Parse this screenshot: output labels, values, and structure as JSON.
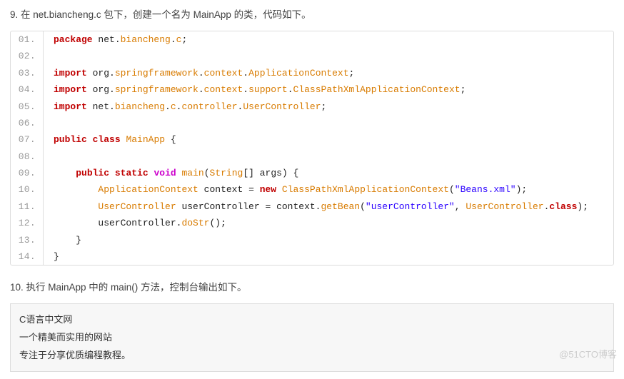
{
  "step9": {
    "heading": "9. 在 net.biancheng.c 包下，创建一个名为 MainApp 的类，代码如下。"
  },
  "code": {
    "lines": [
      {
        "num": "01.",
        "tokens": [
          {
            "cls": "kw-red-bold",
            "t": "package"
          },
          {
            "cls": "tok-container",
            "t": " net."
          },
          {
            "cls": "tok-orange",
            "t": "biancheng"
          },
          {
            "cls": "tok-container",
            "t": "."
          },
          {
            "cls": "tok-orange",
            "t": "c"
          },
          {
            "cls": "tok-container",
            "t": ";"
          }
        ]
      },
      {
        "num": "02.",
        "tokens": []
      },
      {
        "num": "03.",
        "tokens": [
          {
            "cls": "kw-red-bold",
            "t": "import"
          },
          {
            "cls": "tok-container",
            "t": " org."
          },
          {
            "cls": "tok-orange",
            "t": "springframework"
          },
          {
            "cls": "tok-container",
            "t": "."
          },
          {
            "cls": "tok-orange",
            "t": "context"
          },
          {
            "cls": "tok-container",
            "t": "."
          },
          {
            "cls": "tok-orange",
            "t": "ApplicationContext"
          },
          {
            "cls": "tok-container",
            "t": ";"
          }
        ]
      },
      {
        "num": "04.",
        "tokens": [
          {
            "cls": "kw-red-bold",
            "t": "import"
          },
          {
            "cls": "tok-container",
            "t": " org."
          },
          {
            "cls": "tok-orange",
            "t": "springframework"
          },
          {
            "cls": "tok-container",
            "t": "."
          },
          {
            "cls": "tok-orange",
            "t": "context"
          },
          {
            "cls": "tok-container",
            "t": "."
          },
          {
            "cls": "tok-orange",
            "t": "support"
          },
          {
            "cls": "tok-container",
            "t": "."
          },
          {
            "cls": "tok-orange",
            "t": "ClassPathXmlApplicationContext"
          },
          {
            "cls": "tok-container",
            "t": ";"
          }
        ]
      },
      {
        "num": "05.",
        "tokens": [
          {
            "cls": "kw-red-bold",
            "t": "import"
          },
          {
            "cls": "tok-container",
            "t": " net."
          },
          {
            "cls": "tok-orange",
            "t": "biancheng"
          },
          {
            "cls": "tok-container",
            "t": "."
          },
          {
            "cls": "tok-orange",
            "t": "c"
          },
          {
            "cls": "tok-container",
            "t": "."
          },
          {
            "cls": "tok-orange",
            "t": "controller"
          },
          {
            "cls": "tok-container",
            "t": "."
          },
          {
            "cls": "tok-orange",
            "t": "UserController"
          },
          {
            "cls": "tok-container",
            "t": ";"
          }
        ]
      },
      {
        "num": "06.",
        "tokens": []
      },
      {
        "num": "07.",
        "tokens": [
          {
            "cls": "kw-red-bold",
            "t": "public"
          },
          {
            "cls": "tok-plain",
            "t": " "
          },
          {
            "cls": "kw-red-bold",
            "t": "class"
          },
          {
            "cls": "tok-plain",
            "t": " "
          },
          {
            "cls": "tok-orange",
            "t": "MainApp"
          },
          {
            "cls": "tok-plain",
            "t": " {"
          }
        ]
      },
      {
        "num": "08.",
        "tokens": []
      },
      {
        "num": "09.",
        "indent": "    ",
        "tokens": [
          {
            "cls": "kw-red-bold",
            "t": "public"
          },
          {
            "cls": "tok-plain",
            "t": " "
          },
          {
            "cls": "kw-red-bold",
            "t": "static"
          },
          {
            "cls": "tok-plain",
            "t": " "
          },
          {
            "cls": "kw-pink-bold",
            "t": "void"
          },
          {
            "cls": "tok-plain",
            "t": " "
          },
          {
            "cls": "tok-orange",
            "t": "main"
          },
          {
            "cls": "tok-plain",
            "t": "("
          },
          {
            "cls": "tok-orange",
            "t": "String"
          },
          {
            "cls": "tok-plain",
            "t": "[] args) {"
          }
        ]
      },
      {
        "num": "10.",
        "indent": "        ",
        "tokens": [
          {
            "cls": "tok-orange",
            "t": "ApplicationContext"
          },
          {
            "cls": "tok-plain",
            "t": " context = "
          },
          {
            "cls": "kw-red-bold",
            "t": "new"
          },
          {
            "cls": "tok-plain",
            "t": " "
          },
          {
            "cls": "tok-orange",
            "t": "ClassPathXmlApplicationContext"
          },
          {
            "cls": "tok-plain",
            "t": "("
          },
          {
            "cls": "tok-str",
            "t": "\"Beans.xml\""
          },
          {
            "cls": "tok-plain",
            "t": ");"
          }
        ]
      },
      {
        "num": "11.",
        "indent": "        ",
        "tokens": [
          {
            "cls": "tok-orange",
            "t": "UserController"
          },
          {
            "cls": "tok-plain",
            "t": " userController = context."
          },
          {
            "cls": "tok-orange",
            "t": "getBean"
          },
          {
            "cls": "tok-plain",
            "t": "("
          },
          {
            "cls": "tok-str",
            "t": "\"userController\""
          },
          {
            "cls": "tok-plain",
            "t": ", "
          },
          {
            "cls": "tok-orange",
            "t": "UserController"
          },
          {
            "cls": "tok-plain",
            "t": "."
          },
          {
            "cls": "kw-red-bold",
            "t": "class"
          },
          {
            "cls": "tok-plain",
            "t": ");"
          }
        ]
      },
      {
        "num": "12.",
        "indent": "        ",
        "tokens": [
          {
            "cls": "tok-plain",
            "t": "userController."
          },
          {
            "cls": "tok-orange",
            "t": "doStr"
          },
          {
            "cls": "tok-plain",
            "t": "();"
          }
        ]
      },
      {
        "num": "13.",
        "indent": "    ",
        "tokens": [
          {
            "cls": "tok-plain",
            "t": "}"
          }
        ]
      },
      {
        "num": "14.",
        "tokens": [
          {
            "cls": "tok-plain",
            "t": "}"
          }
        ]
      }
    ]
  },
  "step10": {
    "heading": "10. 执行 MainApp 中的 main() 方法，控制台输出如下。"
  },
  "output": {
    "lines": [
      "C语言中文网",
      "一个精美而实用的网站",
      "专注于分享优质编程教程。"
    ]
  },
  "watermark": "@51CTO博客"
}
